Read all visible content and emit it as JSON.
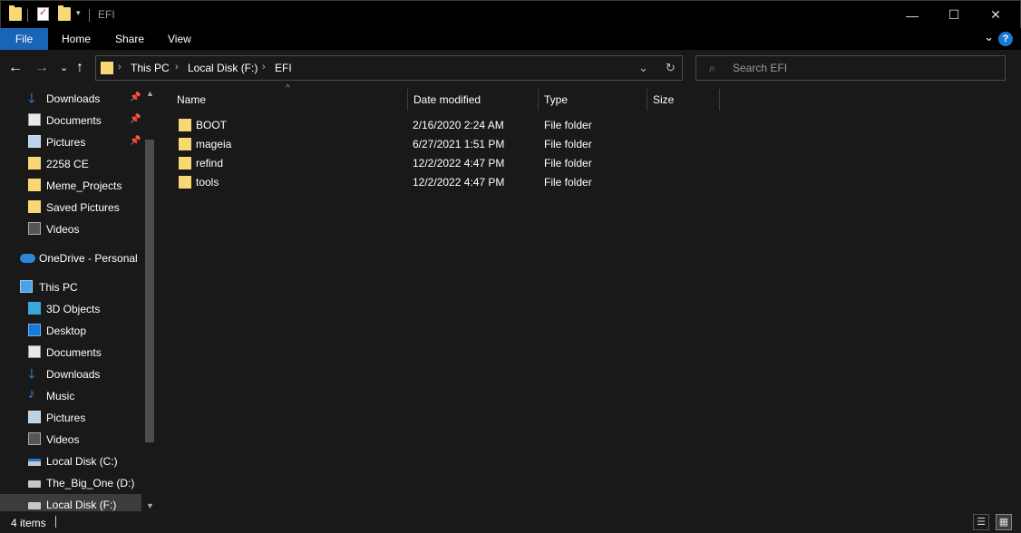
{
  "window": {
    "title": "EFI",
    "quick_access": [
      "folder-icon",
      "properties-icon",
      "new-folder-icon",
      "customize-caret-icon"
    ],
    "controls": {
      "minimize": "—",
      "maximize": "☐",
      "close": "✕"
    }
  },
  "ribbon": {
    "tabs": [
      "File",
      "Home",
      "Share",
      "View"
    ],
    "expand_icon": "⌄",
    "help_label": "?"
  },
  "nav": {
    "back": "←",
    "forward": "→",
    "recent": "⌄",
    "up": "↑",
    "breadcrumb": [
      "This PC",
      "Local Disk (F:)",
      "EFI"
    ],
    "crumb_separator": "›",
    "history_dropdown": "⌄",
    "refresh": "↻"
  },
  "search": {
    "placeholder": "Search EFI",
    "value": ""
  },
  "sidebar": {
    "quick_access": [
      {
        "label": "Downloads",
        "icon": "download-icon",
        "pinned": true
      },
      {
        "label": "Documents",
        "icon": "documents-icon",
        "pinned": true
      },
      {
        "label": "Pictures",
        "icon": "pictures-icon",
        "pinned": true
      },
      {
        "label": "2258 CE",
        "icon": "folder-icon",
        "pinned": false
      },
      {
        "label": "Meme_Projects",
        "icon": "folder-icon",
        "pinned": false
      },
      {
        "label": "Saved Pictures",
        "icon": "folder-icon",
        "pinned": false
      },
      {
        "label": "Videos",
        "icon": "videos-icon",
        "pinned": false
      }
    ],
    "onedrive": {
      "label": "OneDrive - Personal",
      "icon": "onedrive-cloud-icon"
    },
    "this_pc": {
      "label": "This PC",
      "icon": "computer-icon"
    },
    "pc_items": [
      {
        "label": "3D Objects",
        "icon": "3d-objects-icon"
      },
      {
        "label": "Desktop",
        "icon": "desktop-icon"
      },
      {
        "label": "Documents",
        "icon": "documents-icon"
      },
      {
        "label": "Downloads",
        "icon": "download-icon"
      },
      {
        "label": "Music",
        "icon": "music-icon"
      },
      {
        "label": "Pictures",
        "icon": "pictures-icon"
      },
      {
        "label": "Videos",
        "icon": "videos-icon"
      },
      {
        "label": "Local Disk (C:)",
        "icon": "system-drive-icon"
      },
      {
        "label": "The_Big_One (D:)",
        "icon": "drive-icon"
      },
      {
        "label": "Local Disk (F:)",
        "icon": "drive-icon",
        "selected": true
      }
    ],
    "pin_glyph": "📌"
  },
  "columns": [
    "Name",
    "Date modified",
    "Type",
    "Size"
  ],
  "files": [
    {
      "name": "BOOT",
      "date": "2/16/2020 2:24 AM",
      "type": "File folder",
      "size": ""
    },
    {
      "name": "mageia",
      "date": "6/27/2021 1:51 PM",
      "type": "File folder",
      "size": ""
    },
    {
      "name": "refind",
      "date": "12/2/2022 4:47 PM",
      "type": "File folder",
      "size": ""
    },
    {
      "name": "tools",
      "date": "12/2/2022 4:47 PM",
      "type": "File folder",
      "size": ""
    }
  ],
  "status": {
    "item_count": "4 items"
  },
  "colors": {
    "accent": "#1a64b5",
    "folder": "#f8d775",
    "background": "#191919"
  }
}
